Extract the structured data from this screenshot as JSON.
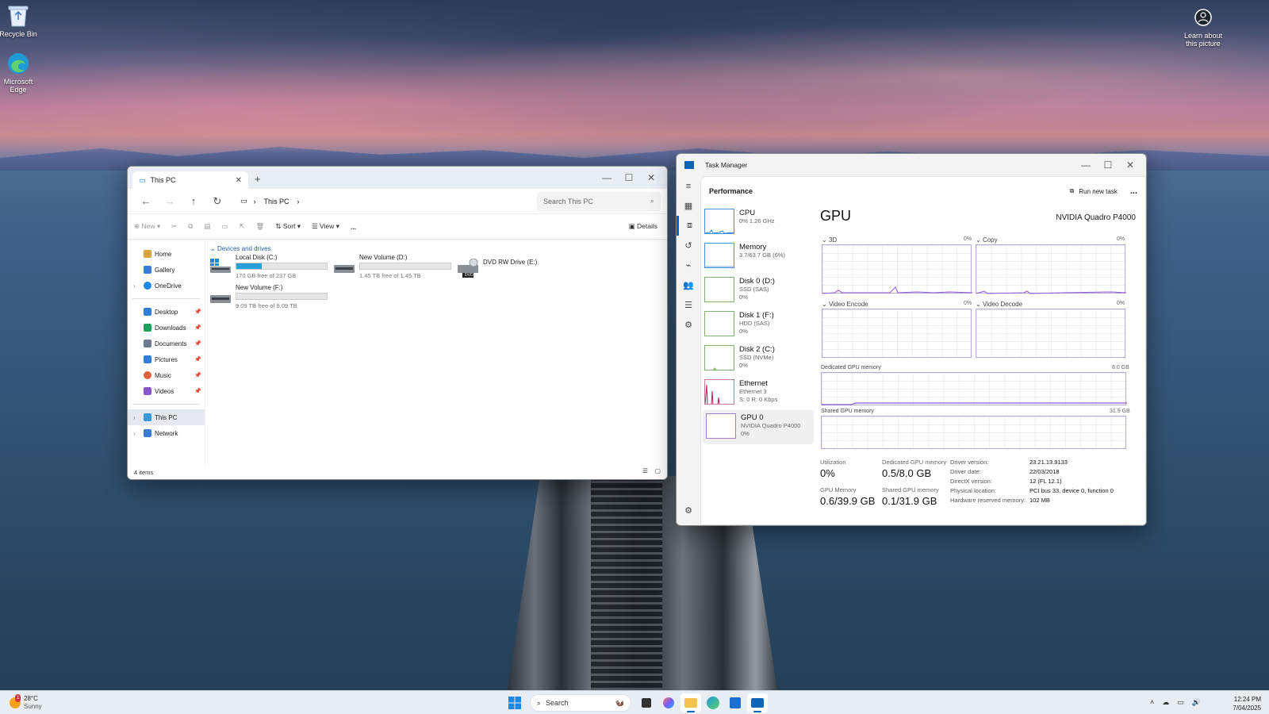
{
  "desktop": {
    "icons": [
      {
        "label": "Recycle Bin",
        "icon": "recycle-bin-icon"
      },
      {
        "label": "Microsoft Edge",
        "icon": "edge-icon"
      }
    ],
    "spotlight_label": "Learn about this picture"
  },
  "explorer": {
    "tab_title": "This PC",
    "new_tab": "+",
    "breadcrumb": "This PC",
    "search_placeholder": "Search This PC",
    "commands": {
      "new": "New",
      "sort": "Sort",
      "view": "View",
      "more": "...",
      "details": "Details"
    },
    "sidebar": [
      {
        "label": "Home",
        "color": "#d9a441"
      },
      {
        "label": "Gallery",
        "color": "#3a7bd5"
      },
      {
        "label": "OneDrive",
        "color": "#1e88e5"
      },
      {
        "label": "Desktop",
        "color": "#2f7fd6"
      },
      {
        "label": "Downloads",
        "color": "#1fa35c"
      },
      {
        "label": "Documents",
        "color": "#6b7a90"
      },
      {
        "label": "Pictures",
        "color": "#2f7fd6"
      },
      {
        "label": "Music",
        "color": "#e0603a"
      },
      {
        "label": "Videos",
        "color": "#8a57c9"
      },
      {
        "label": "This PC",
        "color": "#3a9ad9"
      },
      {
        "label": "Network",
        "color": "#3a7bd5"
      }
    ],
    "group_heading": "Devices and drives",
    "drives": [
      {
        "name": "Local Disk (C:)",
        "free": "170 GB free of 237 GB",
        "used_fraction": 0.28
      },
      {
        "name": "New Volume (D:)",
        "free": "1.45 TB free of 1.45 TB",
        "used_fraction": 0.0
      },
      {
        "name": "DVD RW Drive (E:)",
        "badge": "DVD"
      },
      {
        "name": "New Volume (F:)",
        "free": "9.09 TB free of 9.09 TB",
        "used_fraction": 0.0
      }
    ],
    "status": "4 items"
  },
  "taskmgr": {
    "title": "Task Manager",
    "section": "Performance",
    "run_new_task": "Run new task",
    "more": "...",
    "resources": [
      {
        "name": "CPU",
        "sub1": "0% 1.26 GHz",
        "sub2": ""
      },
      {
        "name": "Memory",
        "sub1": "3.7/63.7 GB (6%)",
        "sub2": ""
      },
      {
        "name": "Disk 0 (D:)",
        "sub1": "SSD (SAS)",
        "sub2": "0%"
      },
      {
        "name": "Disk 1 (F:)",
        "sub1": "HDD (SAS)",
        "sub2": "0%"
      },
      {
        "name": "Disk 2 (C:)",
        "sub1": "SSD (NVMe)",
        "sub2": "0%"
      },
      {
        "name": "Ethernet",
        "sub1": "Ethernet 3",
        "sub2": "S: 0 R: 0 Kbps"
      },
      {
        "name": "GPU 0",
        "sub1": "NVIDIA Quadro P4000",
        "sub2": "0%"
      }
    ],
    "gpu": {
      "title": "GPU",
      "model": "NVIDIA Quadro P4000",
      "graphs": {
        "g3d": {
          "label": "3D",
          "pct": "0%"
        },
        "copy": {
          "label": "Copy",
          "pct": "0%"
        },
        "venc": {
          "label": "Video Encode",
          "pct": "0%"
        },
        "vdec": {
          "label": "Video Decode",
          "pct": "0%"
        },
        "dedicated": {
          "label": "Dedicated GPU memory",
          "max": "8.0 GB"
        },
        "shared": {
          "label": "Shared GPU memory",
          "max": "31.9 GB"
        }
      },
      "stats": {
        "utilization_label": "Utilization",
        "utilization": "0%",
        "dedicated_label": "Dedicated GPU memory",
        "dedicated": "0.5/8.0 GB",
        "gpu_memory_label": "GPU Memory",
        "gpu_memory": "0.6/39.9 GB",
        "shared_label": "Shared GPU memory",
        "shared": "0.1/31.9 GB"
      },
      "info": [
        {
          "k": "Driver version:",
          "v": "23.21.13.9133"
        },
        {
          "k": "Driver date:",
          "v": "22/03/2018"
        },
        {
          "k": "DirectX version:",
          "v": "12 (FL 12.1)"
        },
        {
          "k": "Physical location:",
          "v": "PCI bus 33, device 0, function 0"
        },
        {
          "k": "Hardware reserved memory:",
          "v": "102 MB"
        }
      ]
    }
  },
  "taskbar": {
    "weather_temp": "28°C",
    "weather_desc": "Sunny",
    "weather_badge": "1",
    "search": "Search",
    "time": "12:24 PM",
    "date": "7/04/2025"
  }
}
